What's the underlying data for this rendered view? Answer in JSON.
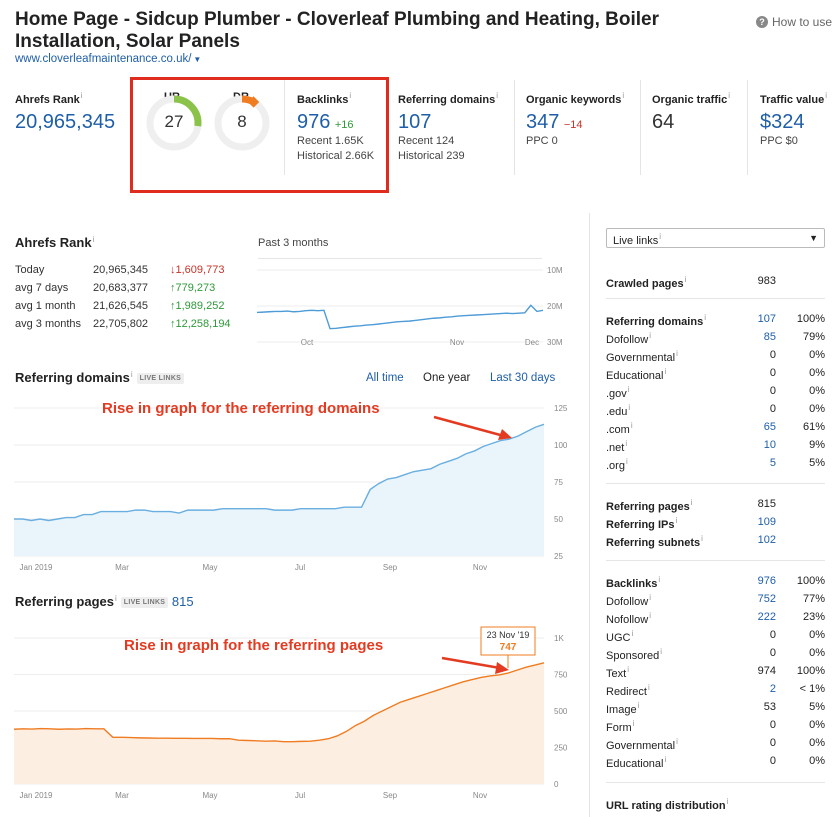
{
  "header": {
    "title": "Home Page - Sidcup Plumber - Cloverleaf Plumbing and Heating, Boiler Installation, Solar Panels",
    "url": "www.cloverleafmaintenance.co.uk/",
    "how_to_use": "How to use"
  },
  "metrics": {
    "ahrefs_rank": {
      "label": "Ahrefs Rank",
      "value": "20,965,345"
    },
    "ur": {
      "label": "UR",
      "value": "27",
      "fill": 0.27,
      "color": "#8bc34a"
    },
    "dr": {
      "label": "DR",
      "value": "8",
      "fill": 0.08,
      "color": "#f07c22"
    },
    "backlinks": {
      "label": "Backlinks",
      "value": "976",
      "delta": "+16",
      "recent": "Recent 1.65K",
      "historical": "Historical 2.66K"
    },
    "referring_domains": {
      "label": "Referring domains",
      "value": "107",
      "recent": "Recent 124",
      "historical": "Historical 239"
    },
    "organic_keywords": {
      "label": "Organic keywords",
      "value": "347",
      "delta": "−14",
      "ppc": "PPC 0"
    },
    "organic_traffic": {
      "label": "Organic traffic",
      "value": "64"
    },
    "traffic_value": {
      "label": "Traffic value",
      "value": "$324",
      "ppc": "PPC $0"
    }
  },
  "ahrefs_rank_section": {
    "title": "Ahrefs Rank",
    "period": "Past 3 months",
    "rows": [
      {
        "label": "Today",
        "value": "20,965,345",
        "change": "↓1,609,773",
        "dir": "down"
      },
      {
        "label": "avg 7 days",
        "value": "20,683,377",
        "change": "↑779,273",
        "dir": "up"
      },
      {
        "label": "avg 1 month",
        "value": "21,626,545",
        "change": "↑1,989,252",
        "dir": "up"
      },
      {
        "label": "avg 3 months",
        "value": "22,705,802",
        "change": "↑12,258,194",
        "dir": "up"
      }
    ],
    "chart_data": {
      "type": "line",
      "x_ticks": [
        "Oct",
        "Nov",
        "Dec"
      ],
      "y_ticks": [
        "10M",
        "20M",
        "30M"
      ],
      "ylim": [
        10000000,
        30000000
      ],
      "y_inverted": true,
      "values": [
        21.8,
        21.7,
        21.6,
        21.5,
        21.5,
        21.4,
        21.6,
        21.5,
        21.3,
        21.2,
        21.3,
        21.2,
        26.3,
        26.2,
        26.0,
        25.8,
        25.6,
        25.5,
        25.3,
        25.2,
        25.0,
        24.8,
        24.6,
        24.4,
        24.3,
        24.2,
        24.0,
        23.8,
        23.6,
        23.4,
        23.3,
        23.1,
        23.0,
        22.8,
        22.7,
        22.6,
        22.5,
        22.4,
        22.3,
        22.2,
        22.1,
        22.0,
        22.1,
        22.0,
        21.9,
        19.8,
        21.5,
        21.2
      ]
    }
  },
  "referring_domains_section": {
    "title": "Referring domains",
    "badge": "LIVE LINKS",
    "tabs": [
      "All time",
      "One year",
      "Last 30 days"
    ],
    "annotation": "Rise in graph for the referring domains",
    "chart_data": {
      "type": "area",
      "x_ticks": [
        "Jan 2019",
        "Mar",
        "May",
        "Jul",
        "Sep",
        "Nov"
      ],
      "y_ticks": [
        "125",
        "100",
        "75",
        "50",
        "25"
      ],
      "ylim": [
        25,
        125
      ],
      "values": [
        50,
        50,
        49,
        50,
        49,
        50,
        51,
        51,
        53,
        53,
        55,
        55,
        55,
        55,
        56,
        56,
        55,
        55,
        55,
        54,
        56,
        56,
        56,
        56,
        57,
        57,
        57,
        57,
        57,
        57,
        56,
        56,
        56,
        57,
        57,
        57,
        57,
        57,
        58,
        58,
        58,
        70,
        74,
        77,
        78,
        80,
        82,
        83,
        84,
        87,
        89,
        91,
        94,
        96,
        99,
        101,
        103,
        104,
        106,
        109,
        112,
        114
      ]
    }
  },
  "referring_pages_section": {
    "title": "Referring pages",
    "badge": "LIVE LINKS",
    "count": "815",
    "annotation": "Rise in graph for the referring pages",
    "tooltip_date": "23 Nov '19",
    "tooltip_value": "747",
    "chart_data": {
      "type": "area",
      "x_ticks": [
        "Jan 2019",
        "Mar",
        "May",
        "Jul",
        "Sep",
        "Nov"
      ],
      "y_ticks": [
        "1K",
        "750",
        "500",
        "250",
        "0"
      ],
      "ylim": [
        0,
        1000
      ],
      "values": [
        375,
        378,
        376,
        380,
        378,
        375,
        377,
        376,
        380,
        378,
        378,
        320,
        320,
        318,
        316,
        315,
        314,
        314,
        313,
        313,
        312,
        312,
        312,
        310,
        310,
        300,
        298,
        296,
        293,
        295,
        290,
        290,
        292,
        293,
        300,
        310,
        330,
        360,
        400,
        430,
        470,
        500,
        530,
        560,
        580,
        600,
        620,
        640,
        660,
        680,
        700,
        715,
        730,
        740,
        747,
        760,
        780,
        800,
        815,
        830
      ]
    }
  },
  "right_panel": {
    "select_label": "Live links",
    "crawled": {
      "label": "Crawled pages",
      "value": "983"
    },
    "group1": [
      {
        "label": "Referring domains",
        "value": "107",
        "pct": "100%",
        "bold": true,
        "link": true
      },
      {
        "label": "Dofollow",
        "value": "85",
        "pct": "79%",
        "link": true
      },
      {
        "label": "Governmental",
        "value": "0",
        "pct": "0%"
      },
      {
        "label": "Educational",
        "value": "0",
        "pct": "0%"
      },
      {
        "label": ".gov",
        "value": "0",
        "pct": "0%"
      },
      {
        "label": ".edu",
        "value": "0",
        "pct": "0%"
      },
      {
        "label": ".com",
        "value": "65",
        "pct": "61%",
        "link": true
      },
      {
        "label": ".net",
        "value": "10",
        "pct": "9%",
        "link": true
      },
      {
        "label": ".org",
        "value": "5",
        "pct": "5%",
        "link": true
      }
    ],
    "group2": [
      {
        "label": "Referring pages",
        "value": "815",
        "bold": true
      },
      {
        "label": "Referring IPs",
        "value": "109",
        "bold": true,
        "link": true
      },
      {
        "label": "Referring subnets",
        "value": "102",
        "bold": true,
        "link": true
      }
    ],
    "group3": [
      {
        "label": "Backlinks",
        "value": "976",
        "pct": "100%",
        "bold": true,
        "link": true
      },
      {
        "label": "Dofollow",
        "value": "752",
        "pct": "77%",
        "link": true
      },
      {
        "label": "Nofollow",
        "value": "222",
        "pct": "23%",
        "link": true
      },
      {
        "label": "UGC",
        "value": "0",
        "pct": "0%"
      },
      {
        "label": "Sponsored",
        "value": "0",
        "pct": "0%"
      },
      {
        "label": "Text",
        "value": "974",
        "pct": "100%"
      },
      {
        "label": "Redirect",
        "value": "2",
        "pct": "< 1%",
        "link": true
      },
      {
        "label": "Image",
        "value": "53",
        "pct": "5%"
      },
      {
        "label": "Form",
        "value": "0",
        "pct": "0%"
      },
      {
        "label": "Governmental",
        "value": "0",
        "pct": "0%"
      },
      {
        "label": "Educational",
        "value": "0",
        "pct": "0%"
      }
    ],
    "url_rating_label": "URL rating distribution"
  }
}
